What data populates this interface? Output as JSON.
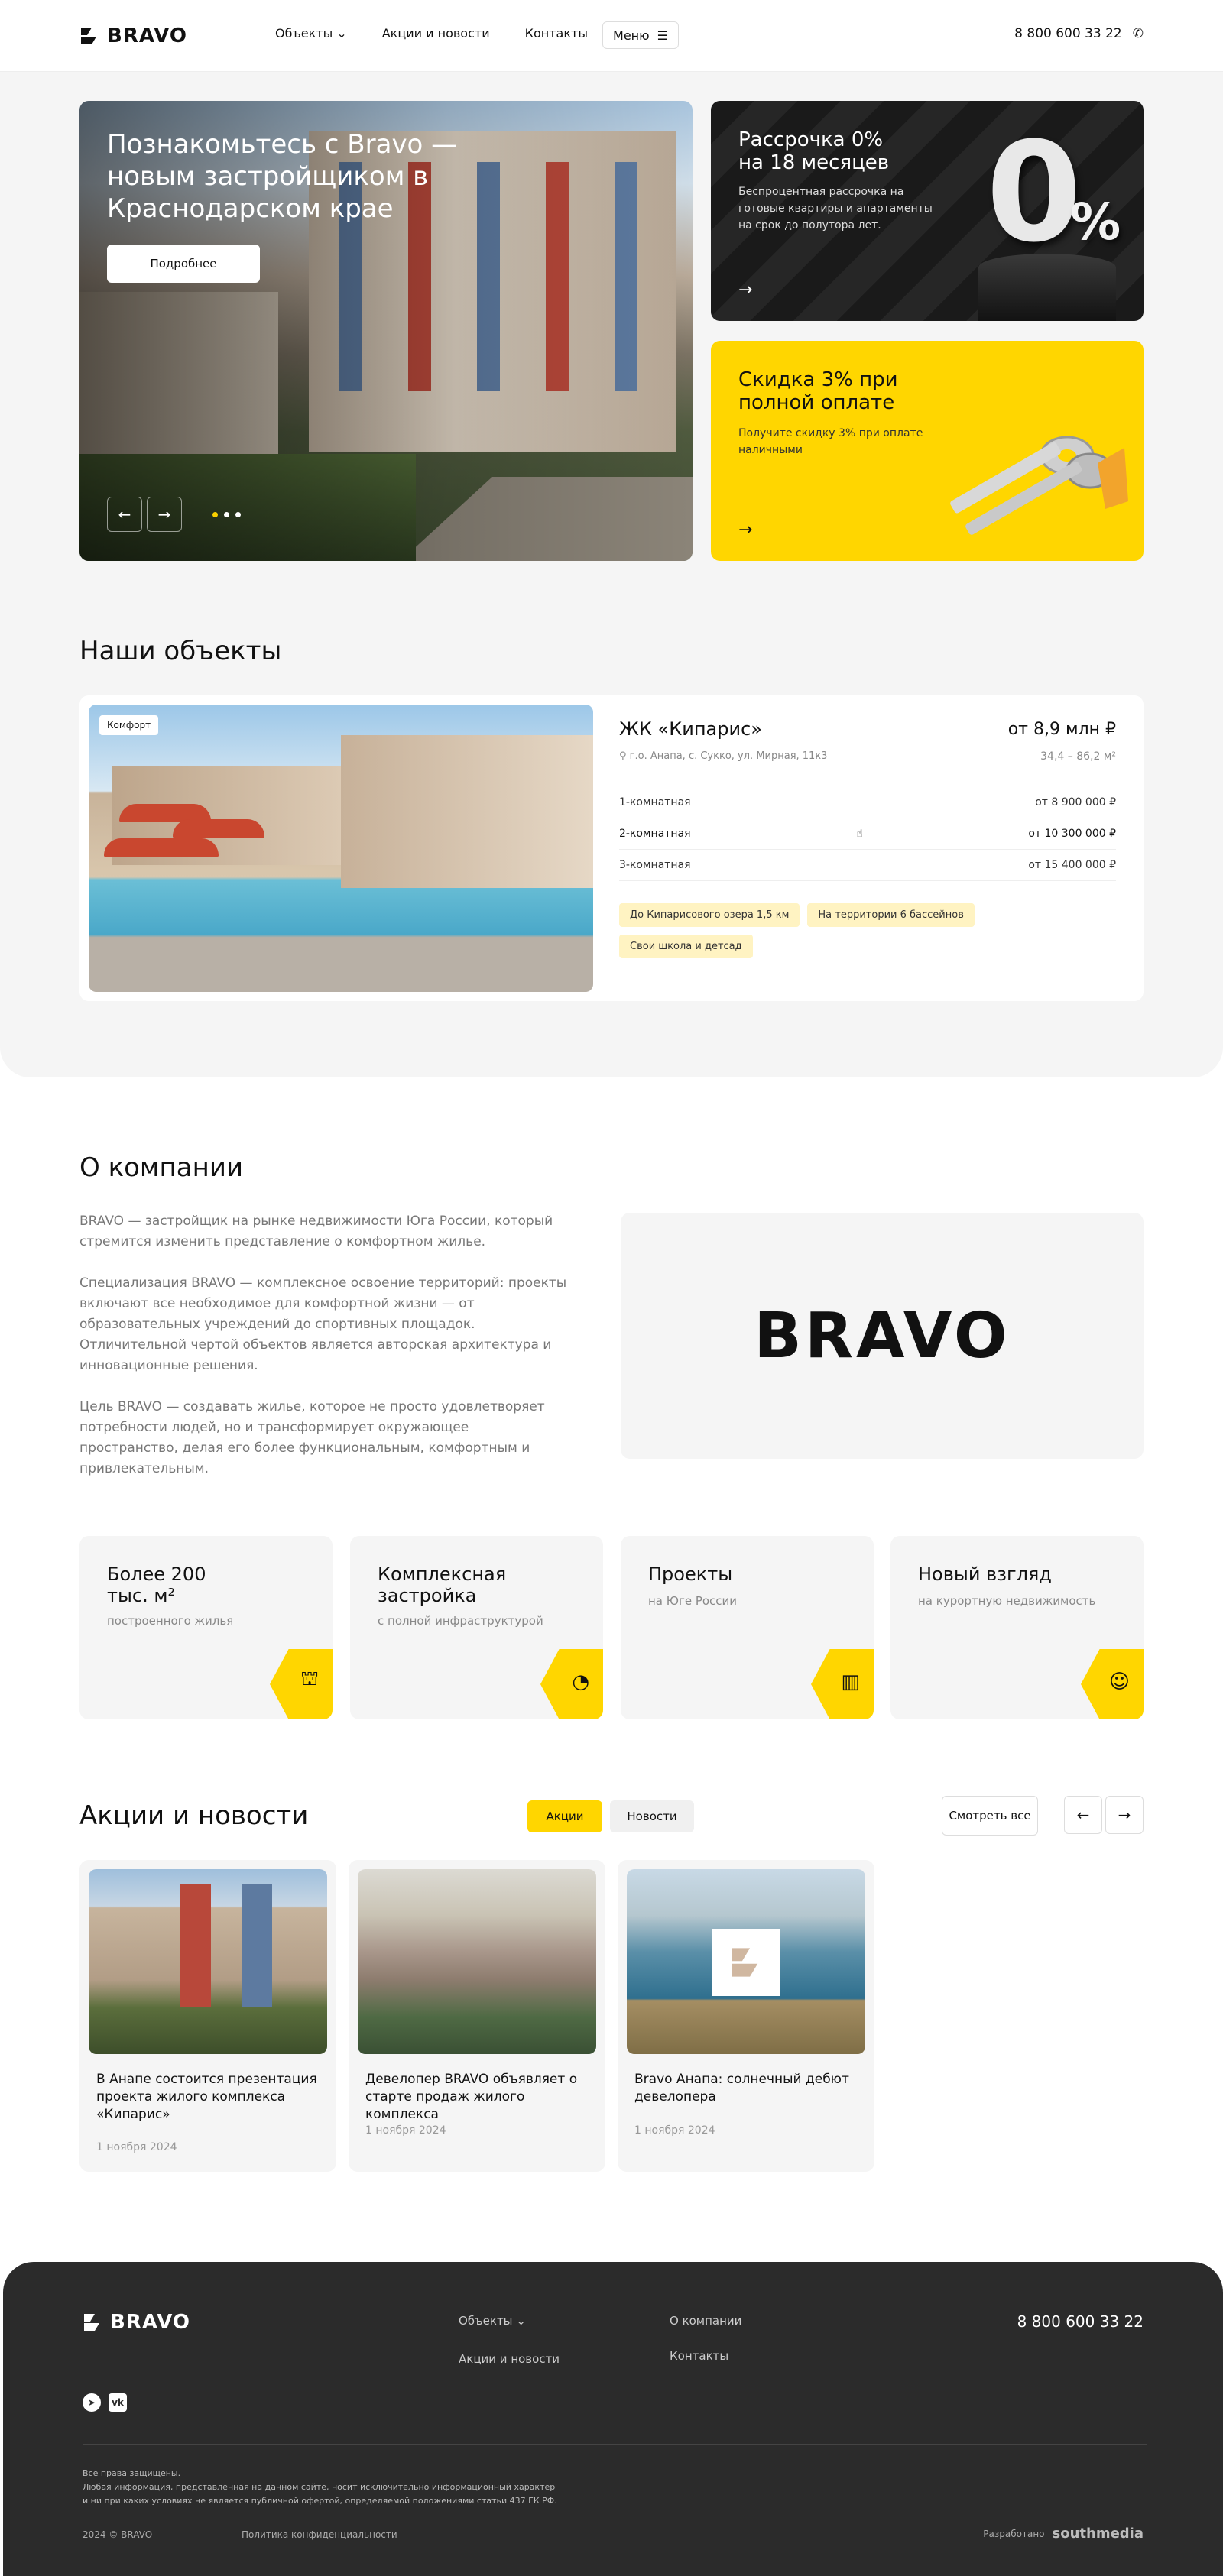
{
  "header": {
    "logo_text": "BRAVO",
    "nav": [
      "Объекты",
      "Акции и новости",
      "Контакты"
    ],
    "menu_label": "Меню",
    "phone": "8 800 600 33 22"
  },
  "hero": {
    "title": "Познакомьтесь с Bravo — новым застройщиком в Краснодарском крае",
    "button": "Подробнее",
    "slides": 3,
    "active_slide": 1
  },
  "promos": [
    {
      "title": "Рассрочка 0% на 18 месяцев",
      "text": "Беспроцентная рассрочка на готовые квартиры и апартаменты на срок до полутора лет.",
      "big": "0",
      "big_pct": "%"
    },
    {
      "title": "Скидка 3% при полной оплате",
      "text": "Получите скидку 3% при оплате наличными"
    }
  ],
  "objects": {
    "title": "Наши объекты",
    "card": {
      "badge": "Комфорт",
      "name": "ЖК «Кипарис»",
      "price": "от 8,9 млн ₽",
      "address": "г.о. Анапа, с. Сукко, ул. Мирная, 11к3",
      "area": "34,4 – 86,2 м²",
      "rows": [
        {
          "label": "1-комнатная",
          "value": "от 8 900 000 ₽"
        },
        {
          "label": "2-комнатная",
          "value": "от 10 300 000 ₽"
        },
        {
          "label": "3-комнатная",
          "value": "от 15 400 000 ₽"
        }
      ],
      "tags": [
        "До Кипарисового озера 1,5 км",
        "На территории 6 бассейнов",
        "Свои школа и детсад"
      ]
    }
  },
  "about": {
    "title": "О компании",
    "p1": "BRAVO — застройщик на рынке недвижимости Юга России, который стремится изменить представление о комфортном жилье.",
    "p2": "Специализация BRAVO — комплексное освоение территорий: проекты включают все необходимое для комфортной жизни — от образовательных учреждений до спортивных площадок. Отличительной чертой объектов является авторская архитектура и инновационные решения.",
    "p3": "Цель BRAVO — создавать жилье, которое не просто удовлетворяет потребности людей, но и трансформирует окружающее пространство, делая его более функциональным, комфортным и привлекательным.",
    "logo": "BRAVO"
  },
  "features": [
    {
      "title": "Более 200 тыс. м²",
      "sub": "построенного жилья",
      "icon": "crane-icon"
    },
    {
      "title": "Комплексная застройка",
      "sub": "с полной инфраструктурой",
      "icon": "chart-icon"
    },
    {
      "title": "Проекты",
      "sub": "на Юге России",
      "icon": "building-icon"
    },
    {
      "title": "Новый взгляд",
      "sub": "на курортную недвижимость",
      "icon": "worker-icon"
    }
  ],
  "news": {
    "title": "Акции и новости",
    "tabs": [
      "Акции",
      "Новости"
    ],
    "see_all": "Смотреть все",
    "items": [
      {
        "title": "В Анапе состоится презентация проекта жилого комплекса «Кипарис»",
        "date": "1 ноября 2024"
      },
      {
        "title": "Девелопер BRAVO объявляет о старте продаж жилого комплекса",
        "date": "1 ноября 2024"
      },
      {
        "title": "Bravo Анапа: солнечный дебют девелопера",
        "date": "1 ноября 2024"
      }
    ]
  },
  "footer": {
    "logo_text": "BRAVO",
    "links_col1": [
      "Объекты",
      "Акции и новости"
    ],
    "links_col2": [
      "О компании",
      "Контакты"
    ],
    "phone": "8 800 600 33 22",
    "legal_1": "Все права защищены.",
    "legal_2": "Любая информация, представленная на данном сайте, носит исключительно информационный характер",
    "legal_3": "и ни при каких условиях не является публичной офертой, определяемой положениями статьи 437 ГК РФ.",
    "copyright": "2024 © BRAVO",
    "privacy": "Политика конфиденциальности",
    "dev_label": "Разработано",
    "dev_name": "southmedia"
  },
  "colors": {
    "accent": "#ffd600",
    "dark": "#2b2b2b",
    "muted": "#f5f5f5"
  }
}
